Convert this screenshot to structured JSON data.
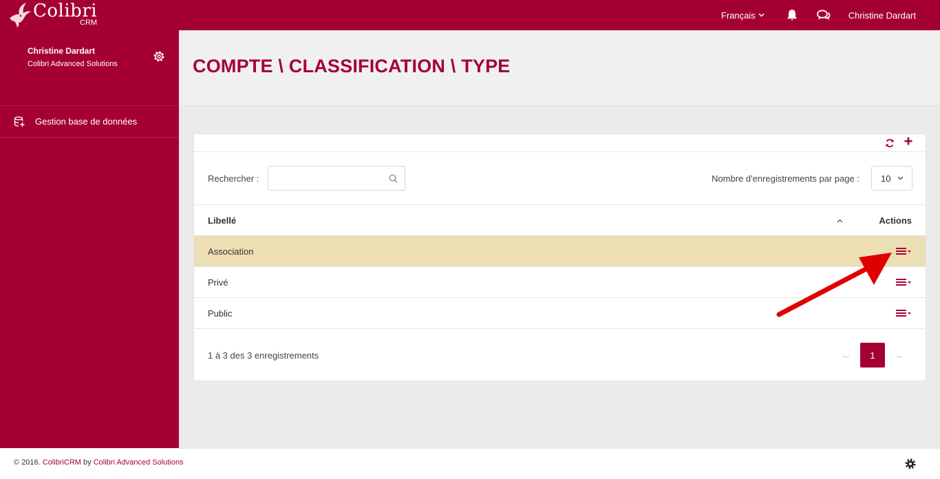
{
  "brand": {
    "name": "Colibri",
    "sub": "CRM"
  },
  "topbar": {
    "language": "Français",
    "user": "Christine Dardart"
  },
  "sidebar": {
    "profile": {
      "name": "Christine Dardart",
      "company": "Colibri Advanced Solutions"
    },
    "items": [
      {
        "label": "Gestion base de données",
        "icon": "database-add-icon"
      }
    ]
  },
  "page": {
    "title": "COMPTE \\ CLASSIFICATION \\ TYPE"
  },
  "table_panel": {
    "search_label": "Rechercher :",
    "search_value": "",
    "per_page_label": "Nombre d'enregistrements par page :",
    "per_page_value": "10",
    "columns": {
      "label": "Libellé",
      "actions": "Actions"
    },
    "sort": "ascending",
    "rows": [
      {
        "label": "Association",
        "highlighted": true
      },
      {
        "label": "Privé",
        "highlighted": false
      },
      {
        "label": "Public",
        "highlighted": false
      }
    ],
    "count_info": "1 à 3 des 3 enregistrements",
    "pagination": {
      "prev": "←",
      "current": "1",
      "next": "→"
    }
  },
  "footer": {
    "prefix": "© 2016. ",
    "product": "ColibriCRM",
    "by": " by ",
    "company": "Colibri Advanced Solutions"
  },
  "colors": {
    "brand": "#a50034",
    "highlight_row": "#ecdfb3",
    "annotation_arrow": "#e00000"
  }
}
